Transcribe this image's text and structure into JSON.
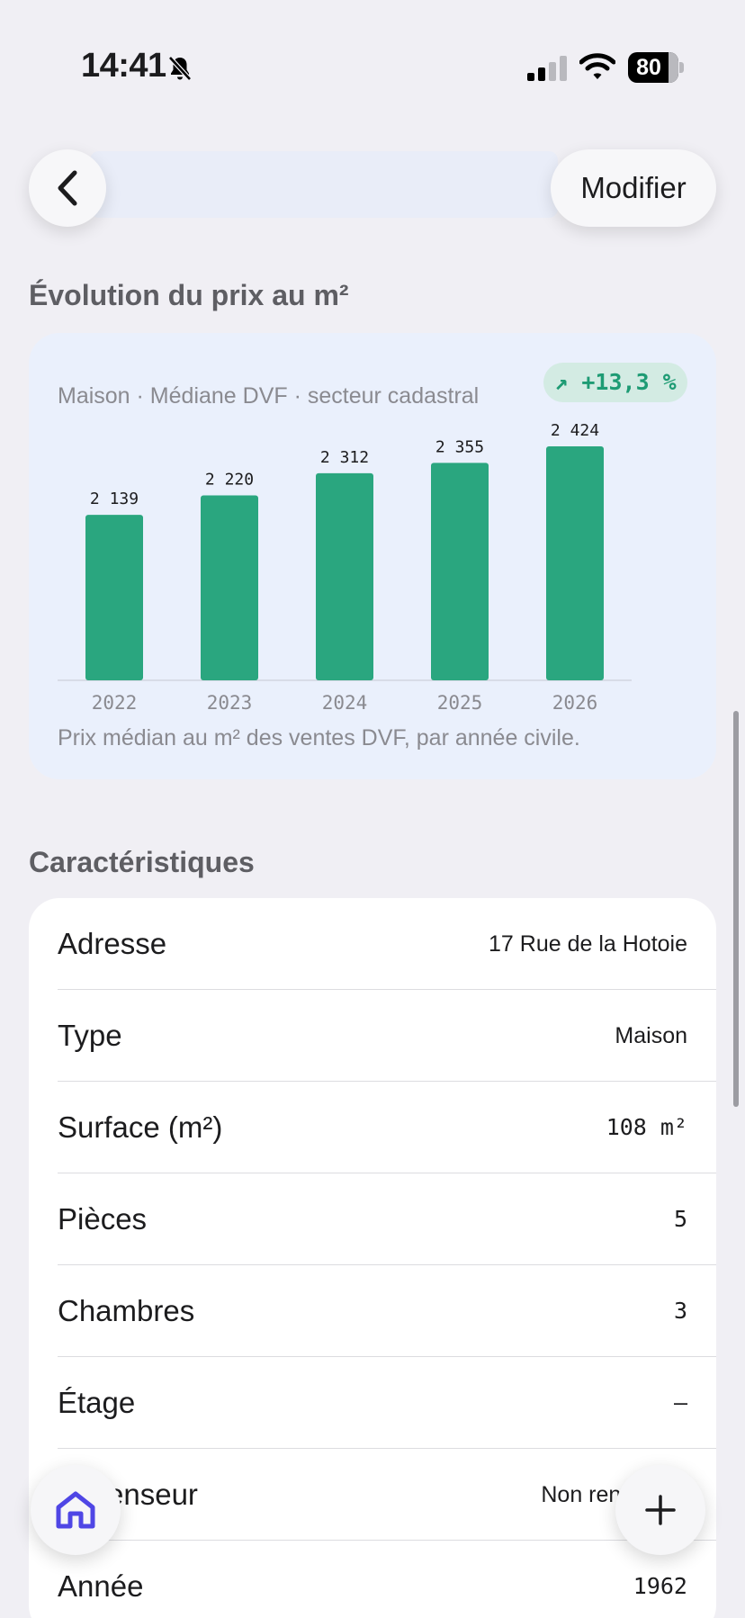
{
  "status_bar": {
    "time": "14:41",
    "battery": "80"
  },
  "nav": {
    "modify_label": "Modifier"
  },
  "price_section": {
    "title": "Évolution du prix au m²",
    "subtitle": "Maison · Médiane DVF · secteur cadastral",
    "trend": "↗ +13,3 %",
    "caption": "Prix médian au m² des ventes DVF, par année civile."
  },
  "chart_data": {
    "type": "bar",
    "categories": [
      "2022",
      "2023",
      "2024",
      "2025",
      "2026"
    ],
    "values": [
      2139,
      2220,
      2312,
      2355,
      2424
    ],
    "value_labels": [
      "2 139",
      "2 220",
      "2 312",
      "2 355",
      "2 424"
    ],
    "color": "#2aa67f"
  },
  "characteristics": {
    "title": "Caractéristiques",
    "rows": [
      {
        "label": "Adresse",
        "value": "17 Rue de la Hotoie"
      },
      {
        "label": "Type",
        "value": "Maison"
      },
      {
        "label": "Surface (m²)",
        "value": "108 m²"
      },
      {
        "label": "Pièces",
        "value": "5"
      },
      {
        "label": "Chambres",
        "value": "3"
      },
      {
        "label": "Étage",
        "value": "–"
      },
      {
        "label": "Ascenseur",
        "value": "Non renseigné"
      },
      {
        "label": "Année",
        "value": "1962"
      }
    ]
  },
  "icons": {
    "back": "chevron-left-icon",
    "home": "home-icon",
    "add": "plus-icon",
    "accent": "#4f46e5"
  }
}
